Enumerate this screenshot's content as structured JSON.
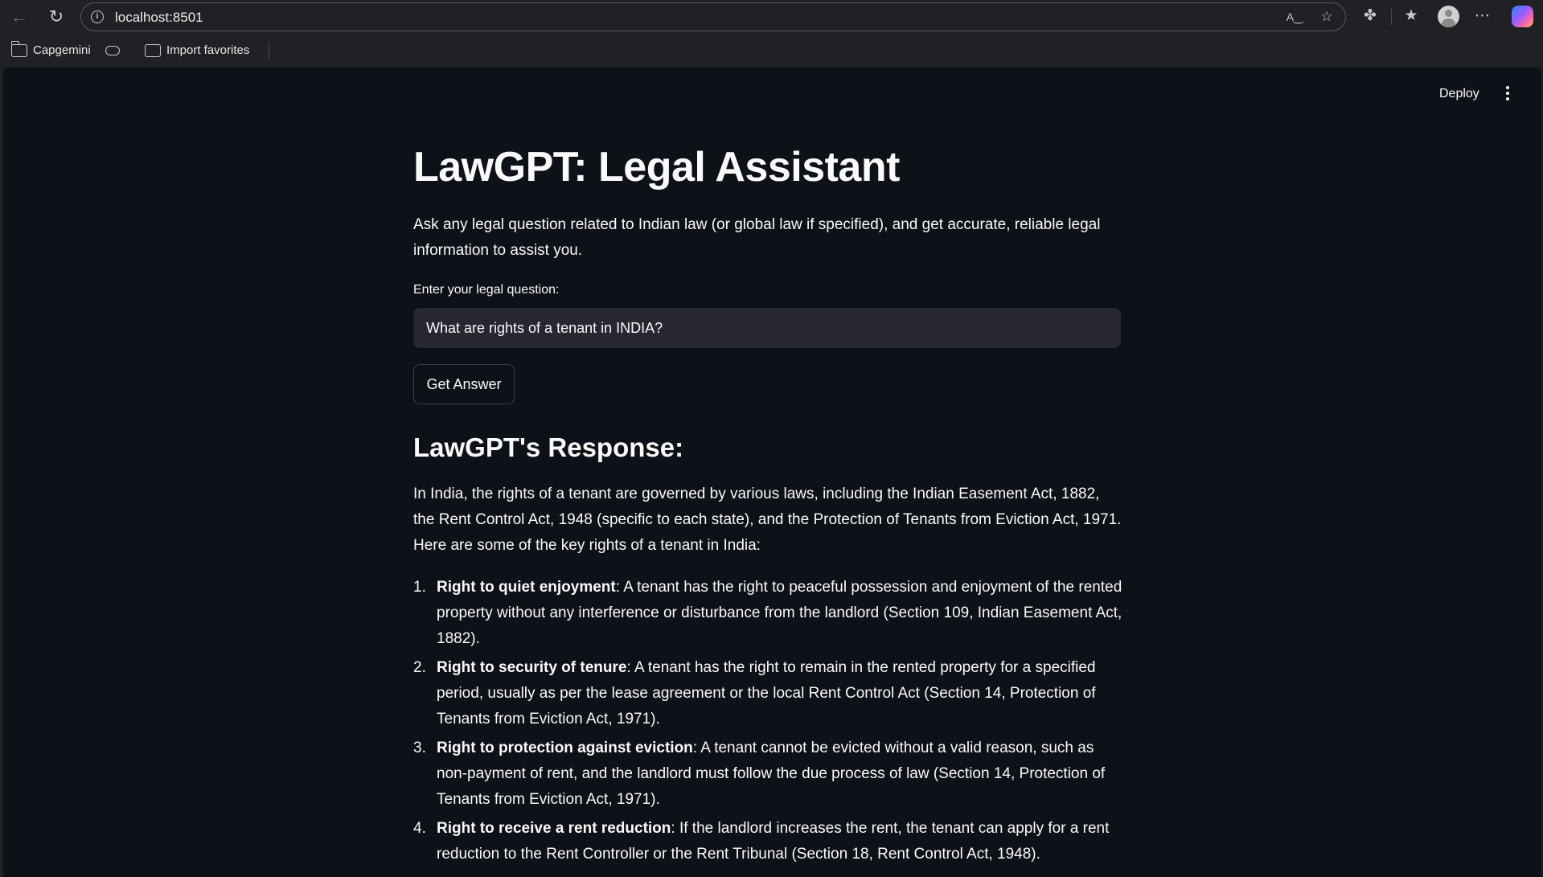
{
  "browser": {
    "url": "localhost:8501",
    "icons": {
      "back": "back-arrow-icon",
      "reload": "reload-icon",
      "site_info": "info-icon",
      "read_aloud": "read-aloud-icon",
      "favorite": "star-icon",
      "extensions": "puzzle-icon",
      "favorites": "favorites-list-icon",
      "profile": "profile-avatar-icon",
      "more": "more-horizontal-icon",
      "copilot": "copilot-icon"
    }
  },
  "favorites_bar": {
    "items": [
      {
        "label": "Capgemini",
        "icon": "folder-icon"
      },
      {
        "label": "",
        "icon": "pill-icon"
      },
      {
        "label": "Import favorites",
        "icon": "import-icon"
      }
    ]
  },
  "app": {
    "deploy_label": "Deploy",
    "title": "LawGPT: Legal Assistant",
    "intro": "Ask any legal question related to Indian law (or global law if specified), and get accurate, reliable legal information to assist you.",
    "question_label": "Enter your legal question:",
    "question_value": "What are rights of a tenant in INDIA?",
    "button_label": "Get Answer",
    "response_heading": "LawGPT's Response:",
    "response_intro": "In India, the rights of a tenant are governed by various laws, including the Indian Easement Act, 1882, the Rent Control Act, 1948 (specific to each state), and the Protection of Tenants from Eviction Act, 1971. Here are some of the key rights of a tenant in India:",
    "response_items": [
      {
        "num": "1.",
        "title": "Right to quiet enjoyment",
        "text": ": A tenant has the right to peaceful possession and enjoyment of the rented property without any interference or disturbance from the landlord (Section 109, Indian Easement Act, 1882)."
      },
      {
        "num": "2.",
        "title": "Right to security of tenure",
        "text": ": A tenant has the right to remain in the rented property for a specified period, usually as per the lease agreement or the local Rent Control Act (Section 14, Protection of Tenants from Eviction Act, 1971)."
      },
      {
        "num": "3.",
        "title": "Right to protection against eviction",
        "text": ": A tenant cannot be evicted without a valid reason, such as non-payment of rent, and the landlord must follow the due process of law (Section 14, Protection of Tenants from Eviction Act, 1971)."
      },
      {
        "num": "4.",
        "title": "Right to receive a rent reduction",
        "text": ": If the landlord increases the rent, the tenant can apply for a rent reduction to the Rent Controller or the Rent Tribunal (Section 18, Rent Control Act, 1948)."
      }
    ]
  },
  "colors": {
    "app_background": "#0e1117",
    "input_background": "#262730",
    "text": "#fafafa",
    "browser_chrome": "#202124"
  }
}
